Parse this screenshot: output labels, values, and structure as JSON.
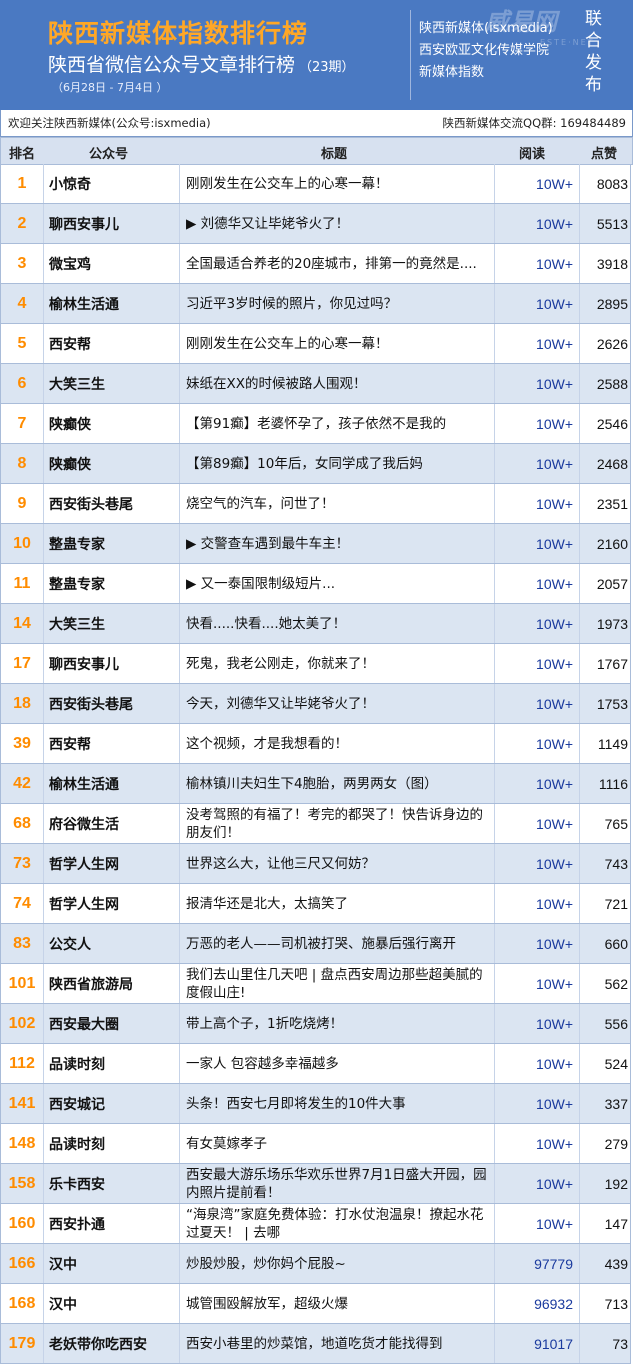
{
  "header": {
    "title": "陕西新媒体指数排行榜",
    "subtitle": "陕西省微信公众号文章排行榜",
    "issue": "（23期）",
    "date_range": "（6月28日 - 7月4日 ）",
    "orgs": [
      "陕西新媒体(isxmedia)",
      "西安欧亚文化传媒学院",
      "新媒体指数"
    ],
    "watermark": "威易网",
    "watermark_sub": "ESTE·NET",
    "vertical_text": "联合发布"
  },
  "info_bar": {
    "left": "欢迎关注陕西新媒体(公众号:isxmedia)",
    "right": "陕西新媒体交流QQ群: 169484489"
  },
  "table": {
    "columns": [
      "排名",
      "公众号",
      "标题",
      "阅读",
      "点赞"
    ],
    "rows": [
      {
        "rank": "1",
        "account": "小惊奇",
        "title": "刚刚发生在公交车上的心寒一幕！",
        "reads": "10W+",
        "likes": "8083"
      },
      {
        "rank": "2",
        "account": "聊西安事儿",
        "title": "▶ 刘德华又让毕姥爷火了！",
        "reads": "10W+",
        "likes": "5513"
      },
      {
        "rank": "3",
        "account": "微宝鸡",
        "title": "全国最适合养老的20座城市，排第一的竟然是....",
        "reads": "10W+",
        "likes": "3918"
      },
      {
        "rank": "4",
        "account": "榆林生活通",
        "title": "习近平3岁时候的照片，你见过吗？",
        "reads": "10W+",
        "likes": "2895"
      },
      {
        "rank": "5",
        "account": "西安帮",
        "title": "刚刚发生在公交车上的心寒一幕！",
        "reads": "10W+",
        "likes": "2626"
      },
      {
        "rank": "6",
        "account": "大笑三生",
        "title": "妹纸在XX的时候被路人围观！",
        "reads": "10W+",
        "likes": "2588"
      },
      {
        "rank": "7",
        "account": "陕癫侠",
        "title": "【第91癫】老婆怀孕了，孩子依然不是我的",
        "reads": "10W+",
        "likes": "2546"
      },
      {
        "rank": "8",
        "account": "陕癫侠",
        "title": "【第89癫】10年后，女同学成了我后妈",
        "reads": "10W+",
        "likes": "2468"
      },
      {
        "rank": "9",
        "account": "西安街头巷尾",
        "title": "烧空气的汽车，问世了！",
        "reads": "10W+",
        "likes": "2351"
      },
      {
        "rank": "10",
        "account": "整蛊专家",
        "title": "▶ 交警查车遇到最牛车主！",
        "reads": "10W+",
        "likes": "2160"
      },
      {
        "rank": "11",
        "account": "整蛊专家",
        "title": "▶ 又一泰国限制级短片...",
        "reads": "10W+",
        "likes": "2057"
      },
      {
        "rank": "14",
        "account": "大笑三生",
        "title": "快看.....快看....她太美了！",
        "reads": "10W+",
        "likes": "1973"
      },
      {
        "rank": "17",
        "account": "聊西安事儿",
        "title": "死鬼，我老公刚走，你就来了！",
        "reads": "10W+",
        "likes": "1767"
      },
      {
        "rank": "18",
        "account": "西安街头巷尾",
        "title": "今天，刘德华又让毕姥爷火了！",
        "reads": "10W+",
        "likes": "1753"
      },
      {
        "rank": "39",
        "account": "西安帮",
        "title": "这个视频，才是我想看的！",
        "reads": "10W+",
        "likes": "1149"
      },
      {
        "rank": "42",
        "account": "榆林生活通",
        "title": "榆林镇川夫妇生下4胞胎，两男两女（图）",
        "reads": "10W+",
        "likes": "1116"
      },
      {
        "rank": "68",
        "account": "府谷微生活",
        "title": "没考驾照的有福了！考完的都哭了！快告诉身边的朋友们！",
        "reads": "10W+",
        "likes": "765"
      },
      {
        "rank": "73",
        "account": "哲学人生网",
        "title": "世界这么大，让他三尺又何妨？",
        "reads": "10W+",
        "likes": "743"
      },
      {
        "rank": "74",
        "account": "哲学人生网",
        "title": "报清华还是北大，太搞笑了",
        "reads": "10W+",
        "likes": "721"
      },
      {
        "rank": "83",
        "account": "公交人",
        "title": "万恶的老人——司机被打哭、施暴后强行离开",
        "reads": "10W+",
        "likes": "660"
      },
      {
        "rank": "101",
        "account": "陕西省旅游局",
        "title": "我们去山里住几天吧 | 盘点西安周边那些超美腻的度假山庄!",
        "reads": "10W+",
        "likes": "562"
      },
      {
        "rank": "102",
        "account": "西安最大圈",
        "title": "带上高个子，1折吃烧烤！",
        "reads": "10W+",
        "likes": "556"
      },
      {
        "rank": "112",
        "account": "品读时刻",
        "title": "一家人 包容越多幸福越多",
        "reads": "10W+",
        "likes": "524"
      },
      {
        "rank": "141",
        "account": "西安城记",
        "title": "头条！西安七月即将发生的10件大事",
        "reads": "10W+",
        "likes": "337"
      },
      {
        "rank": "148",
        "account": "品读时刻",
        "title": "有女莫嫁孝子",
        "reads": "10W+",
        "likes": "279"
      },
      {
        "rank": "158",
        "account": "乐卡西安",
        "title": "西安最大游乐场乐华欢乐世界7月1日盛大开园，园内照片提前看！",
        "reads": "10W+",
        "likes": "192"
      },
      {
        "rank": "160",
        "account": "西安扑通",
        "title": "“海泉湾”家庭免费体验：打水仗泡温泉！撩起水花过夏天！ | 去哪",
        "reads": "10W+",
        "likes": "147"
      },
      {
        "rank": "166",
        "account": "汉中",
        "title": "炒股炒股，炒你妈个屁股~",
        "reads": "97779",
        "likes": "439"
      },
      {
        "rank": "168",
        "account": "汉中",
        "title": "城管围殴解放军，超级火爆",
        "reads": "96932",
        "likes": "713"
      },
      {
        "rank": "179",
        "account": "老妖带你吃西安",
        "title": "西安小巷里的炒菜馆，地道吃货才能找得到",
        "reads": "91017",
        "likes": "73"
      }
    ]
  }
}
